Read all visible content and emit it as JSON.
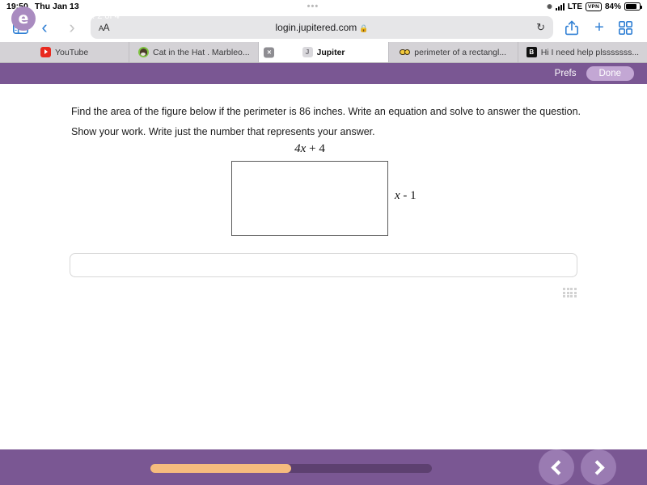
{
  "statusbar": {
    "time": "19:50",
    "date": "Thu Jan 13",
    "center_dots": "•••",
    "bluetooth_icon": "bluetooth-sync-icon",
    "signal_icon": "cellular-bars-icon",
    "network": "LTE",
    "vpn_badge": "VPN",
    "battery_percent": "84%",
    "battery_icon": "battery-icon"
  },
  "toolbar": {
    "sidebar_icon": "sidebar-toggle-icon",
    "back_icon": "chevron-left-icon",
    "forward_icon": "chevron-right-icon",
    "text_size_label": "AA",
    "url": "login.jupitered.com",
    "lock_icon": "lock-icon",
    "reload_icon": "reload-icon",
    "share_icon": "share-icon",
    "new_tab_label": "+",
    "tabs_overview_icon": "tab-grid-icon"
  },
  "tabs": [
    {
      "label": "YouTube",
      "favicon": "youtube-icon",
      "active": false,
      "has_close": false
    },
    {
      "label": "Cat in the Hat . Marbleo...",
      "favicon": "cat-icon",
      "active": false,
      "has_close": false
    },
    {
      "label": "Jupiter",
      "favicon": "jupiter-icon",
      "active": true,
      "has_close": true,
      "close_label": "×"
    },
    {
      "label": "perimeter of a rectangl...",
      "favicon": "eyes-icon",
      "active": false,
      "has_close": false
    },
    {
      "label": "Hi I need help plsssssss...",
      "favicon": "brainly-icon",
      "active": false,
      "has_close": false
    }
  ],
  "jupiter_header": {
    "prefs_label": "Prefs",
    "done_label": "Done",
    "bar_color": "#7a5793",
    "done_button_color": "#c3a7d4"
  },
  "question": {
    "line1": "Find the area of the figure below if the perimeter is 86 inches. Write an equation and solve to answer the question.",
    "line2": "Show your work. Write just the number that represents your answer."
  },
  "figure": {
    "shape": "rectangle",
    "top_label_coefficient": "4x",
    "top_label_operator": " + ",
    "top_label_constant": "4",
    "top_label": "4x + 4",
    "right_label_variable": "x",
    "right_label_operator": " - ",
    "right_label_constant": "1",
    "right_label": "x - 1"
  },
  "answer_field": {
    "value": "",
    "placeholder": "",
    "resize_grip_icon": "resize-grip-icon"
  },
  "footer": {
    "logo_glyph": "e",
    "logo_name": "jupiter-logo-icon",
    "page_label": "p. 2 of 4",
    "progress_percent": 50,
    "progress_fill_color": "#f6bc7e",
    "progress_track_color": "#5d4070",
    "prev_icon": "chevron-left-icon",
    "next_icon": "chevron-right-icon",
    "bar_color": "#7a5793"
  }
}
